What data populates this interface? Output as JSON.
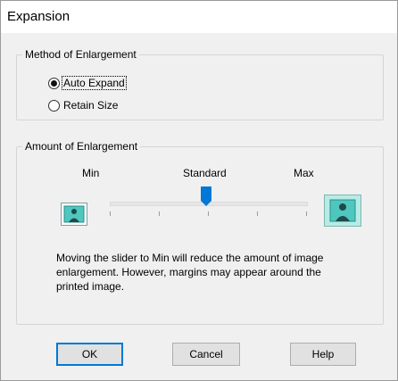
{
  "window": {
    "title": "Expansion"
  },
  "method_group": {
    "label": "Method of Enlargement",
    "options": [
      {
        "label": "Auto Expand",
        "selected": true
      },
      {
        "label": "Retain Size",
        "selected": false
      }
    ]
  },
  "amount_group": {
    "label": "Amount of Enlargement",
    "slider": {
      "min_label": "Min",
      "standard_label": "Standard",
      "max_label": "Max",
      "position_steps": 5,
      "value_index": 2
    },
    "description": "Moving the slider to Min will reduce the amount of image enlargement. However, margins may appear around the printed image."
  },
  "buttons": {
    "ok": "OK",
    "cancel": "Cancel",
    "help": "Help"
  },
  "colors": {
    "accent": "#0078d7",
    "image_teal": "#4fc7bf",
    "image_large_bg": "#b7ebe6"
  },
  "icons": {
    "small_image": "image-small-icon",
    "large_image": "image-large-icon",
    "thumb": "slider-thumb"
  }
}
